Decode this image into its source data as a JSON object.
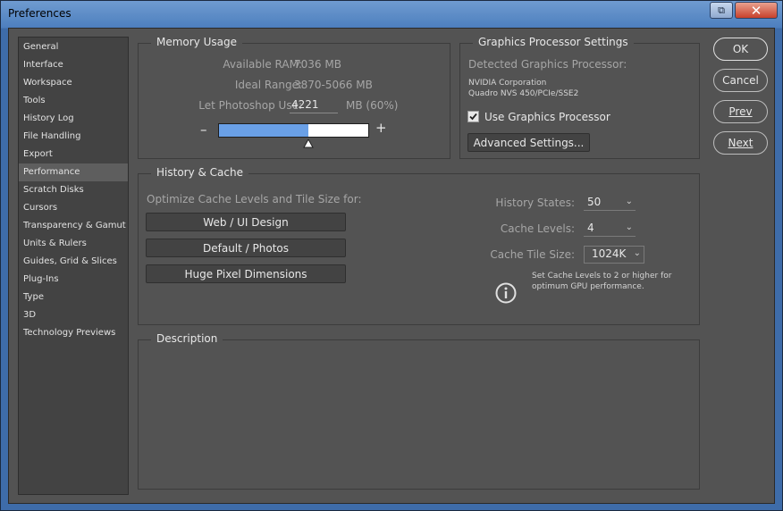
{
  "window": {
    "title": "Preferences",
    "restore_label": "⧉",
    "close_label": "✕"
  },
  "sidebar": {
    "items": [
      "General",
      "Interface",
      "Workspace",
      "Tools",
      "History Log",
      "File Handling",
      "Export",
      "Performance",
      "Scratch Disks",
      "Cursors",
      "Transparency & Gamut",
      "Units & Rulers",
      "Guides, Grid & Slices",
      "Plug-Ins",
      "Type",
      "3D",
      "Technology Previews"
    ],
    "selected": "Performance"
  },
  "memory": {
    "title": "Memory Usage",
    "available_label": "Available RAM:",
    "available_value": "7036 MB",
    "ideal_label": "Ideal Range:",
    "ideal_value": "3870-5066 MB",
    "use_label": "Let Photoshop Use:",
    "use_value": "4221",
    "use_unit": "MB (60%)",
    "minus": "–",
    "plus": "+",
    "slider_fraction": 0.6
  },
  "gpu": {
    "title": "Graphics Processor Settings",
    "detected_label": "Detected Graphics Processor:",
    "vendor": "NVIDIA Corporation",
    "model": "Quadro NVS 450/PCIe/SSE2",
    "use_label": "Use Graphics Processor",
    "use_checked": true,
    "advanced_label": "Advanced Settings..."
  },
  "history": {
    "title": "History & Cache",
    "optimize_label": "Optimize Cache Levels and Tile Size for:",
    "buttons": [
      "Web / UI Design",
      "Default / Photos",
      "Huge Pixel Dimensions"
    ],
    "states_label": "History States:",
    "states_value": "50",
    "levels_label": "Cache Levels:",
    "levels_value": "4",
    "tile_label": "Cache Tile Size:",
    "tile_value": "1024K",
    "tip_line1": "Set Cache Levels to 2 or higher for",
    "tip_line2": "optimum GPU performance."
  },
  "description": {
    "title": "Description"
  },
  "actions": {
    "ok": "OK",
    "cancel": "Cancel",
    "prev": "Prev",
    "next": "Next"
  }
}
